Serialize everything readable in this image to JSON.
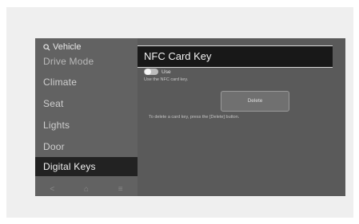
{
  "sidebar": {
    "search_label": "Vehicle",
    "items": [
      {
        "label": "Drive Mode"
      },
      {
        "label": "Climate"
      },
      {
        "label": "Seat"
      },
      {
        "label": "Lights"
      },
      {
        "label": "Door"
      },
      {
        "label": "Digital Keys"
      }
    ],
    "bottom_nav": [
      "<",
      "⌂",
      "≡"
    ]
  },
  "main": {
    "title": "NFC Card Key",
    "toggle_label": "Use",
    "hint": "Use the NFC card key.",
    "delete_label": "Delete",
    "description": "To delete a card key, press the [Delete] button."
  },
  "icons": {
    "search": "search-icon",
    "back": "back-icon",
    "home": "home-icon",
    "menu": "menu-icon"
  }
}
